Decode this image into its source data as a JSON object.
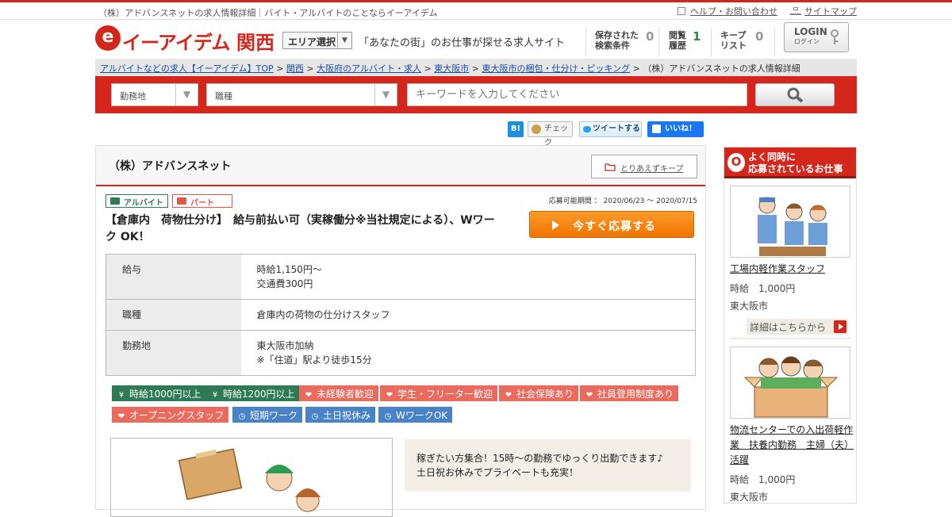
{
  "site": {
    "top_title": "（株）アドバンスネットの求人情報詳細｜バイト・アルバイトのことならイーアイデム",
    "help_link": "ヘルプ・お問い合わせ",
    "sitemap_link": "サイトマップ",
    "logo_mark": "e",
    "logo_name": "イーアイデム",
    "region": "関西",
    "area_select": "エリア選択",
    "tagline": "「あなたの街」のお仕事が探せる求人サイト",
    "brand_color": "#d4261a"
  },
  "stats": [
    {
      "label1": "保存された",
      "label2": "検索条件",
      "count": "0"
    },
    {
      "label1": "閲覧",
      "label2": "履歴",
      "count": "1"
    },
    {
      "label1": "キープ",
      "label2": "リスト",
      "count": "0"
    }
  ],
  "login": {
    "label": "LOGIN",
    "sub": "ログイン"
  },
  "breadcrumb": {
    "items": [
      "アルバイトなどの求人【イーアイデム】TOP",
      "関西",
      "大阪府のアルバイト・求人",
      "東大阪市",
      "東大阪市の梱包・仕分け・ピッキング"
    ],
    "sep": ">",
    "current": "（株）アドバンスネットの求人情報詳細"
  },
  "search": {
    "location_label": "勤務地",
    "job_type_label": "職種",
    "keyword_placeholder": "キーワードを入力してください"
  },
  "social": {
    "hatena": "B!",
    "mixi_check": "チェック",
    "tweet": "ツイートする",
    "like": "いいね！"
  },
  "job": {
    "company": "（株）アドバンスネット",
    "keep_button": "とりあえずキープ",
    "employment_types": [
      "アルバイト",
      "パート"
    ],
    "period_label": "応募可能期間",
    "period_sep": "：",
    "period_value": "2020/06/23 ～ 2020/07/15",
    "title": "【倉庫内　荷物仕分け】　給与前払い可（実稼働分※当社規定による）、Wワーク OK！",
    "apply_button": "今すぐ応募する",
    "details": [
      {
        "label": "給与",
        "line1": "時給1,150円〜",
        "line2": "交通費300円"
      },
      {
        "label": "職種",
        "line1": "倉庫内の荷物の仕分けスタッフ",
        "line2": ""
      },
      {
        "label": "勤務地",
        "line1": "東大阪市加納",
        "line2": "※「住道」駅より徒歩15分"
      }
    ],
    "tags": [
      {
        "text": "時給1000円以上",
        "kind": "yen"
      },
      {
        "text": "時給1200円以上",
        "kind": "yen"
      },
      {
        "text": "未経験者歓迎",
        "kind": "heart"
      },
      {
        "text": "学生・フリーター歓迎",
        "kind": "heart"
      },
      {
        "text": "社会保険あり",
        "kind": "heart"
      },
      {
        "text": "社員登用制度あり",
        "kind": "heart"
      },
      {
        "text": "オープニングスタッフ",
        "kind": "heart"
      },
      {
        "text": "短期ワーク",
        "kind": "clock"
      },
      {
        "text": "土日祝休み",
        "kind": "clock"
      },
      {
        "text": "WワークOK",
        "kind": "clock"
      }
    ],
    "description_line1": "稼ぎたい方集合！15時〜の勤務でゆっくり出勤できます♪",
    "description_line2": "土日祝お休みでプライベートも充実！"
  },
  "sidebar": {
    "header_line1": "よく同時に",
    "header_line2": "応募されているお仕事",
    "header_badge": "O",
    "detail_link": "詳細はこちらから",
    "items": [
      {
        "title": "工場内軽作業スタッフ",
        "wage": "時給　1,000円",
        "place": "東大阪市"
      },
      {
        "title": "物流センターでの入出荷軽作業　扶養内勤務　主婦（夫）活躍",
        "wage": "時給　1,000円",
        "place": "東大阪市"
      }
    ]
  }
}
